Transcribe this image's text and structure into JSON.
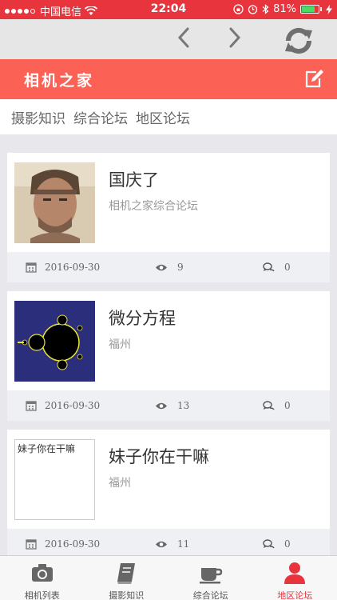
{
  "status_bar": {
    "carrier": "中国电信",
    "time": "22:04",
    "battery": "81%",
    "battery_level": 0.81
  },
  "header": {
    "title": "相机之家"
  },
  "categories": [
    "摄影知识",
    "综合论坛",
    "地区论坛"
  ],
  "posts": [
    {
      "title": "国庆了",
      "subtitle": "相机之家综合论坛",
      "date": "2016-09-30",
      "views": "9",
      "comments": "0",
      "thumb": "portrait"
    },
    {
      "title": "微分方程",
      "subtitle": "福州",
      "date": "2016-09-30",
      "views": "13",
      "comments": "0",
      "thumb": "fractal"
    },
    {
      "title": "妹子你在干嘛",
      "subtitle": "福州",
      "date": "2016-09-30",
      "views": "11",
      "comments": "0",
      "thumb_text": "妹子你在干嘛"
    }
  ],
  "tabs": [
    {
      "label": "相机列表",
      "icon": "camera-icon"
    },
    {
      "label": "摄影知识",
      "icon": "book-icon"
    },
    {
      "label": "综合论坛",
      "icon": "coffee-cup-icon"
    },
    {
      "label": "地区论坛",
      "icon": "user-icon",
      "active": true
    }
  ],
  "colors": {
    "accent": "#e8343c",
    "header": "#fc6156"
  }
}
